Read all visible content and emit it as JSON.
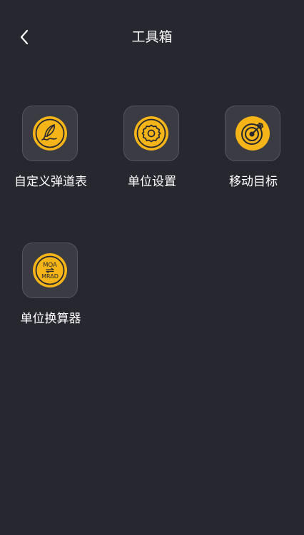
{
  "header": {
    "title": "工具箱",
    "back_icon": "chevron-left-icon"
  },
  "tools": [
    {
      "label": "自定义弹道表",
      "icon": "feather-pen-icon"
    },
    {
      "label": "单位设置",
      "icon": "gear-settings-icon"
    },
    {
      "label": "移动目标",
      "icon": "target-arrow-icon"
    },
    {
      "label": "单位换算器",
      "icon": "unit-converter-icon",
      "icon_text_top": "MOA",
      "icon_text_bottom": "MRAD"
    }
  ],
  "colors": {
    "background": "#272730",
    "tile": "#3b3b44",
    "tile_border": "#55555e",
    "accent": "#f5b518",
    "text": "#ffffff"
  }
}
